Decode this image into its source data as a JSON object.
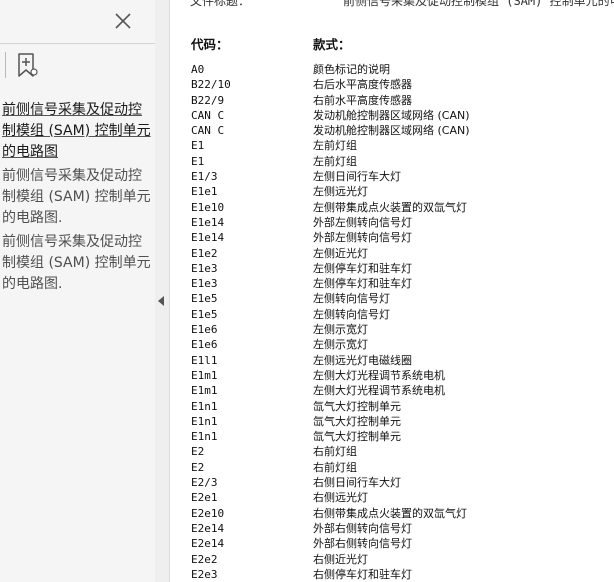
{
  "sidebar": {
    "bookmarks": [
      {
        "label": "前侧信号采集及促动控制模组 (SAM) 控制单元的电路图",
        "selected": true
      },
      {
        "label": "前侧信号采集及促动控制模组 (SAM) 控制单元的电路图.",
        "selected": false
      },
      {
        "label": "前侧信号采集及促动控制模组 (SAM) 控制单元的电路图.",
        "selected": false
      }
    ]
  },
  "document": {
    "title_label": "文件标题：",
    "title_value": "前侧信号采集及促动控制模组 (SAM) 控制单元的电",
    "header": {
      "code": "代码：",
      "desc": "款式："
    },
    "rows": [
      {
        "code": "A0",
        "desc": "颜色标记的说明"
      },
      {
        "code": "B22/10",
        "desc": "右后水平高度传感器"
      },
      {
        "code": "B22/9",
        "desc": "右前水平高度传感器"
      },
      {
        "code": "CAN C",
        "desc": "发动机舱控制器区域网络 (CAN)"
      },
      {
        "code": "CAN C",
        "desc": "发动机舱控制器区域网络 (CAN)"
      },
      {
        "code": "E1",
        "desc": "左前灯组"
      },
      {
        "code": "E1",
        "desc": "左前灯组"
      },
      {
        "code": "E1/3",
        "desc": "左侧日间行车大灯"
      },
      {
        "code": "E1e1",
        "desc": "左侧远光灯"
      },
      {
        "code": "E1e10",
        "desc": "左侧带集成点火装置的双氙气灯"
      },
      {
        "code": "E1e14",
        "desc": "外部左侧转向信号灯"
      },
      {
        "code": "E1e14",
        "desc": "外部左侧转向信号灯"
      },
      {
        "code": "E1e2",
        "desc": "左侧近光灯"
      },
      {
        "code": "E1e3",
        "desc": "左侧停车灯和驻车灯"
      },
      {
        "code": "E1e3",
        "desc": "左侧停车灯和驻车灯"
      },
      {
        "code": "E1e5",
        "desc": "左侧转向信号灯"
      },
      {
        "code": "E1e5",
        "desc": "左侧转向信号灯"
      },
      {
        "code": "E1e6",
        "desc": "左侧示宽灯"
      },
      {
        "code": "E1e6",
        "desc": "左侧示宽灯"
      },
      {
        "code": "E1l1",
        "desc": "左侧远光灯电磁线圈"
      },
      {
        "code": "E1m1",
        "desc": "左侧大灯光程调节系统电机"
      },
      {
        "code": "E1m1",
        "desc": "左侧大灯光程调节系统电机"
      },
      {
        "code": "E1n1",
        "desc": "氙气大灯控制单元"
      },
      {
        "code": "E1n1",
        "desc": "氙气大灯控制单元"
      },
      {
        "code": "E1n1",
        "desc": "氙气大灯控制单元"
      },
      {
        "code": "E2",
        "desc": "右前灯组"
      },
      {
        "code": "E2",
        "desc": "右前灯组"
      },
      {
        "code": "E2/3",
        "desc": "右侧日间行车大灯"
      },
      {
        "code": "E2e1",
        "desc": "右侧远光灯"
      },
      {
        "code": "E2e10",
        "desc": "右侧带集成点火装置的双氙气灯"
      },
      {
        "code": "E2e14",
        "desc": "外部右侧转向信号灯"
      },
      {
        "code": "E2e14",
        "desc": "外部右侧转向信号灯"
      },
      {
        "code": "E2e2",
        "desc": "右侧近光灯"
      },
      {
        "code": "E2e3",
        "desc": "右侧停车灯和驻车灯"
      }
    ]
  },
  "icons": {
    "close": "close-icon",
    "bookmark": "bookmark-add-icon",
    "collapse": "chevron-left-icon"
  }
}
